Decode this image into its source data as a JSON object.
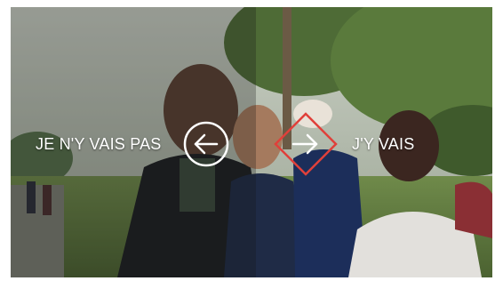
{
  "choices": {
    "left": {
      "label": "JE N'Y VAIS PAS",
      "icon": "arrow-left-icon"
    },
    "right": {
      "label": "J'Y VAIS",
      "icon": "arrow-right-icon"
    }
  },
  "colors": {
    "accent": "#e0403a",
    "text": "#ffffff"
  }
}
